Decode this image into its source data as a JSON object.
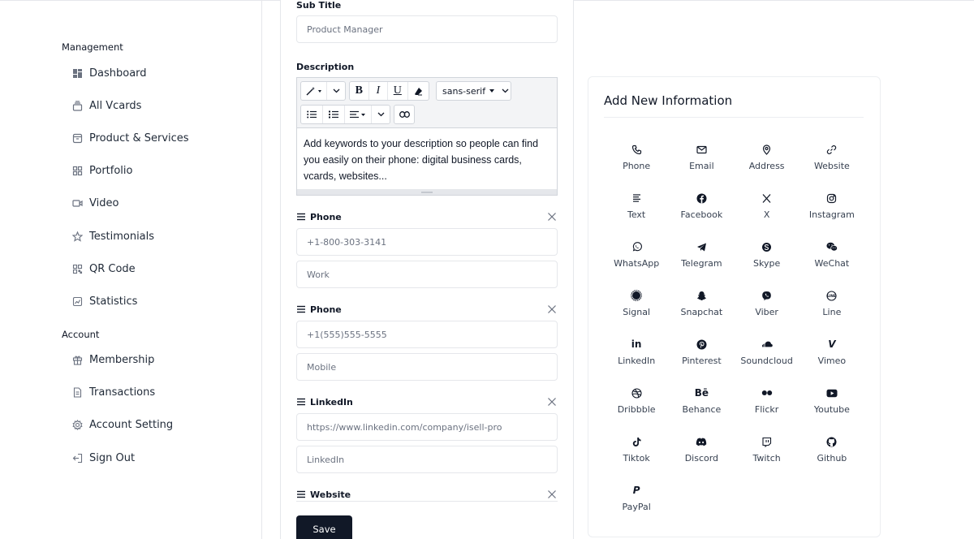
{
  "sidebar": {
    "management_label": "Management",
    "account_label": "Account",
    "management_items": [
      {
        "label": "Dashboard",
        "icon": "dashboard-icon"
      },
      {
        "label": "All Vcards",
        "icon": "vcards-icon"
      },
      {
        "label": "Product & Services",
        "icon": "product-icon"
      },
      {
        "label": "Portfolio",
        "icon": "portfolio-icon"
      },
      {
        "label": "Video",
        "icon": "video-icon"
      },
      {
        "label": "Testimonials",
        "icon": "star-icon"
      },
      {
        "label": "QR Code",
        "icon": "qr-code-icon"
      },
      {
        "label": "Statistics",
        "icon": "chart-icon"
      }
    ],
    "account_items": [
      {
        "label": "Membership",
        "icon": "gift-icon"
      },
      {
        "label": "Transactions",
        "icon": "document-icon"
      },
      {
        "label": "Account Setting",
        "icon": "gear-icon"
      },
      {
        "label": "Sign Out",
        "icon": "sign-out-icon"
      }
    ]
  },
  "form": {
    "subtitle_label": "Sub Title",
    "subtitle_placeholder": "Product Manager",
    "description_label": "Description",
    "editor": {
      "font_name": "sans-serif",
      "bold": "B",
      "italic": "I",
      "underline": "U",
      "content": "Add keywords to your description so people can find you easily on their phone: digital business cards, vcards, websites..."
    },
    "groups": [
      {
        "title": "Phone",
        "value_placeholder": "+1-800-303-3141",
        "label_placeholder": "Work"
      },
      {
        "title": "Phone",
        "value_placeholder": "+1(555)555-5555",
        "label_placeholder": "Mobile"
      },
      {
        "title": "LinkedIn",
        "value_placeholder": "https://www.linkedin.com/company/isell-pro",
        "label_placeholder": "LinkedIn"
      },
      {
        "title": "Website"
      }
    ],
    "save_label": "Save"
  },
  "info_panel": {
    "title": "Add New Information",
    "items": [
      {
        "label": "Phone",
        "icon": "phone-icon"
      },
      {
        "label": "Email",
        "icon": "email-icon"
      },
      {
        "label": "Address",
        "icon": "location-pin-icon"
      },
      {
        "label": "Website",
        "icon": "link-icon"
      },
      {
        "label": "Text",
        "icon": "text-lines-icon"
      },
      {
        "label": "Facebook",
        "icon": "facebook-icon"
      },
      {
        "label": "X",
        "icon": "x-icon"
      },
      {
        "label": "Instagram",
        "icon": "instagram-icon"
      },
      {
        "label": "WhatsApp",
        "icon": "whatsapp-icon"
      },
      {
        "label": "Telegram",
        "icon": "telegram-icon"
      },
      {
        "label": "Skype",
        "icon": "skype-icon"
      },
      {
        "label": "WeChat",
        "icon": "wechat-icon"
      },
      {
        "label": "Signal",
        "icon": "signal-icon"
      },
      {
        "label": "Snapchat",
        "icon": "snapchat-icon"
      },
      {
        "label": "Viber",
        "icon": "viber-icon"
      },
      {
        "label": "Line",
        "icon": "line-icon"
      },
      {
        "label": "LinkedIn",
        "icon": "linkedin-icon",
        "glyph": "in"
      },
      {
        "label": "Pinterest",
        "icon": "pinterest-icon"
      },
      {
        "label": "Soundcloud",
        "icon": "soundcloud-icon"
      },
      {
        "label": "Vimeo",
        "icon": "vimeo-icon",
        "glyph": "V"
      },
      {
        "label": "Dribbble",
        "icon": "dribbble-icon"
      },
      {
        "label": "Behance",
        "icon": "behance-icon",
        "glyph": "Bē"
      },
      {
        "label": "Flickr",
        "icon": "flickr-icon"
      },
      {
        "label": "Youtube",
        "icon": "youtube-icon"
      },
      {
        "label": "Tiktok",
        "icon": "tiktok-icon"
      },
      {
        "label": "Discord",
        "icon": "discord-icon"
      },
      {
        "label": "Twitch",
        "icon": "twitch-icon"
      },
      {
        "label": "Github",
        "icon": "github-icon"
      },
      {
        "label": "PayPal",
        "icon": "paypal-icon",
        "glyph": "P"
      }
    ]
  },
  "colors": {
    "primary_button": "#111827",
    "border": "#e5e7eb",
    "toolbar_bg": "#f3f4f6"
  }
}
